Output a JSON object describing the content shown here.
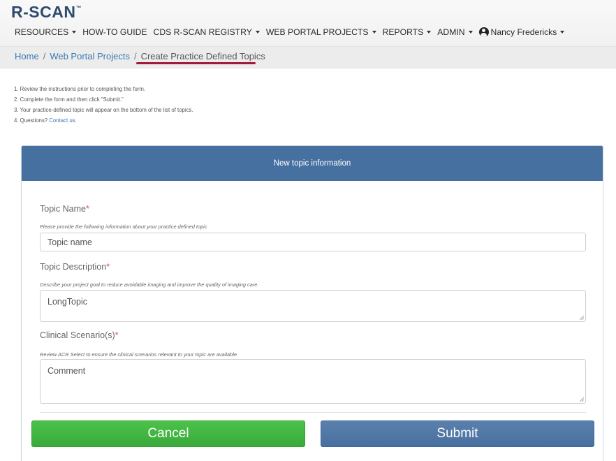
{
  "brand": {
    "logo_text": "R-SCAN",
    "logo_tm": "™"
  },
  "nav": {
    "items": [
      {
        "label": "RESOURCES",
        "dropdown": true
      },
      {
        "label": "HOW-TO GUIDE",
        "dropdown": false
      },
      {
        "label": "CDS R-SCAN REGISTRY",
        "dropdown": true
      },
      {
        "label": "WEB PORTAL PROJECTS",
        "dropdown": true
      },
      {
        "label": "REPORTS",
        "dropdown": true
      },
      {
        "label": "ADMIN",
        "dropdown": true
      }
    ],
    "user": {
      "name": "Nancy Fredericks",
      "icon": "user-circle-icon",
      "dropdown": true
    }
  },
  "breadcrumb": {
    "items": [
      "Home",
      "Web Portal Projects"
    ],
    "separator": "/",
    "active": "Create Practice Defined Topics",
    "highlight_color": "#a01a3a"
  },
  "instructions": {
    "lines": [
      "1. Review the instructions prior to completing the form.",
      "2. Complete the form and then click \"Submit.\"",
      "3. Your practice-defined topic will appear on the bottom of the list of topics.",
      "4. Questions? "
    ],
    "contact_link": "Contact us."
  },
  "panel": {
    "title": "New topic information",
    "header_color": "#4670a0",
    "fields": {
      "topic_name": {
        "label": "Topic Name",
        "required_mark": "*",
        "help": "Please provide the following information about your practice defined topic",
        "placeholder": "Topic name"
      },
      "topic_description": {
        "label": "Topic Description",
        "required_mark": "*",
        "help": "Describe your project goal to reduce avoidable imaging and improve the quality of imaging care.",
        "value": "LongTopic"
      },
      "clinical_scenarios": {
        "label": "Clinical Scenario(s)",
        "required_mark": "*",
        "help": "Review ACR Select to ensure the clinical scenarios relevant to your topic are available.",
        "placeholder": "Comment"
      }
    }
  },
  "buttons": {
    "cancel": {
      "label": "Cancel",
      "color": "#3fb13e"
    },
    "submit": {
      "label": "Submit",
      "color": "#4f76a5"
    }
  }
}
